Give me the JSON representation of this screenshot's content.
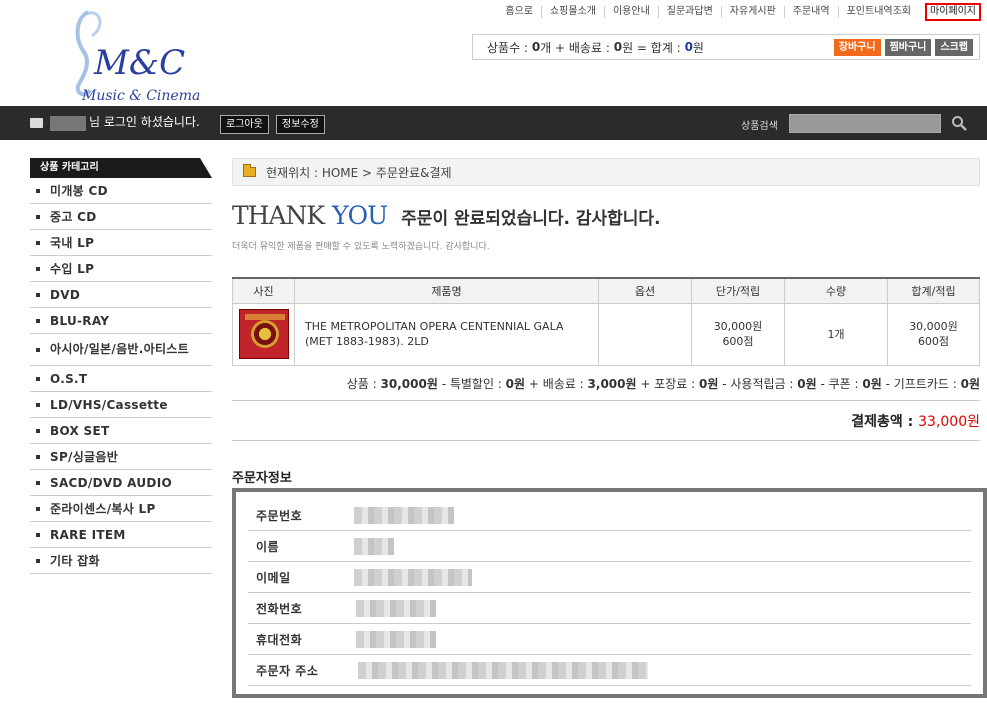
{
  "logo": {
    "main": "M&C",
    "sub": "Music & Cinema"
  },
  "topnav": [
    "홈으로",
    "쇼핑몰소개",
    "이용안내",
    "질문과답변",
    "자유게시판",
    "주문내역",
    "포인트내역조회",
    "마이페이지"
  ],
  "cart": {
    "text_items": "상품수 :",
    "items": "0",
    "text_items_unit": "개 + 배송료 :",
    "shipping": "0",
    "text_ship_unit": "원 = 합계 :",
    "total": "0",
    "text_total_unit": "원",
    "buttons": [
      "장바구니",
      "찜바구니",
      "스크랩"
    ]
  },
  "topbar": {
    "login_text": "님 로그인 하셨습니다.",
    "logout": "로그아웃",
    "edit_info": "정보수정",
    "search_label": "상품검색"
  },
  "sidebar": {
    "title": "상품 카테고리",
    "items": [
      "미개봉 CD",
      "중고 CD",
      "국내 LP",
      "수입 LP",
      "DVD",
      "BLU-RAY",
      "아시아/일본/음반.아티스트",
      "O.S.T",
      "LD/VHS/Cassette",
      "BOX SET",
      "SP/싱글음반",
      "SACD/DVD AUDIO",
      "준라이센스/복사 LP",
      "RARE ITEM",
      "기타 잡화"
    ]
  },
  "breadcrumb": "현재위치 : HOME > 주문완료&결제",
  "thanks": {
    "t1": "THANK",
    "t2": "YOU",
    "msg": "주문이 완료되었습니다. 감사합니다.",
    "sub": "더욱더 유익한 제품을 판매할 수 있도록 노력하겠습니다. 감사합니다."
  },
  "table": {
    "headers": [
      "사진",
      "제품명",
      "옵션",
      "단가/적립",
      "수량",
      "합계/적립"
    ],
    "row": {
      "name_line1": "THE METROPOLITAN OPERA CENTENNIAL GALA",
      "name_line2": "(MET 1883-1983). 2LD",
      "option": "",
      "price": "30,000원",
      "price_point": "600점",
      "qty": "1개",
      "sum": "30,000원",
      "sum_point": "600점"
    }
  },
  "summary": {
    "p1": "상품 : ",
    "product": "30,000원",
    "p2": " - 특별할인 : ",
    "discount": "0원",
    "p3": " + 배송료 : ",
    "ship": "3,000원",
    "p4": " + 포장료 : ",
    "pack": "0원",
    "p5": " - 사용적립금 : ",
    "points": "0원",
    "p6": " - 쿠폰 : ",
    "coupon": "0원",
    "p7": " - 기프트카드 : ",
    "gift": "0원"
  },
  "total": {
    "label": "결제총액 : ",
    "amount": "33,000원"
  },
  "orderer": {
    "title": "주문자정보",
    "labels": [
      "주문번호",
      "이름",
      "이메일",
      "전화번호",
      "휴대전화",
      "주문자 주소"
    ]
  }
}
